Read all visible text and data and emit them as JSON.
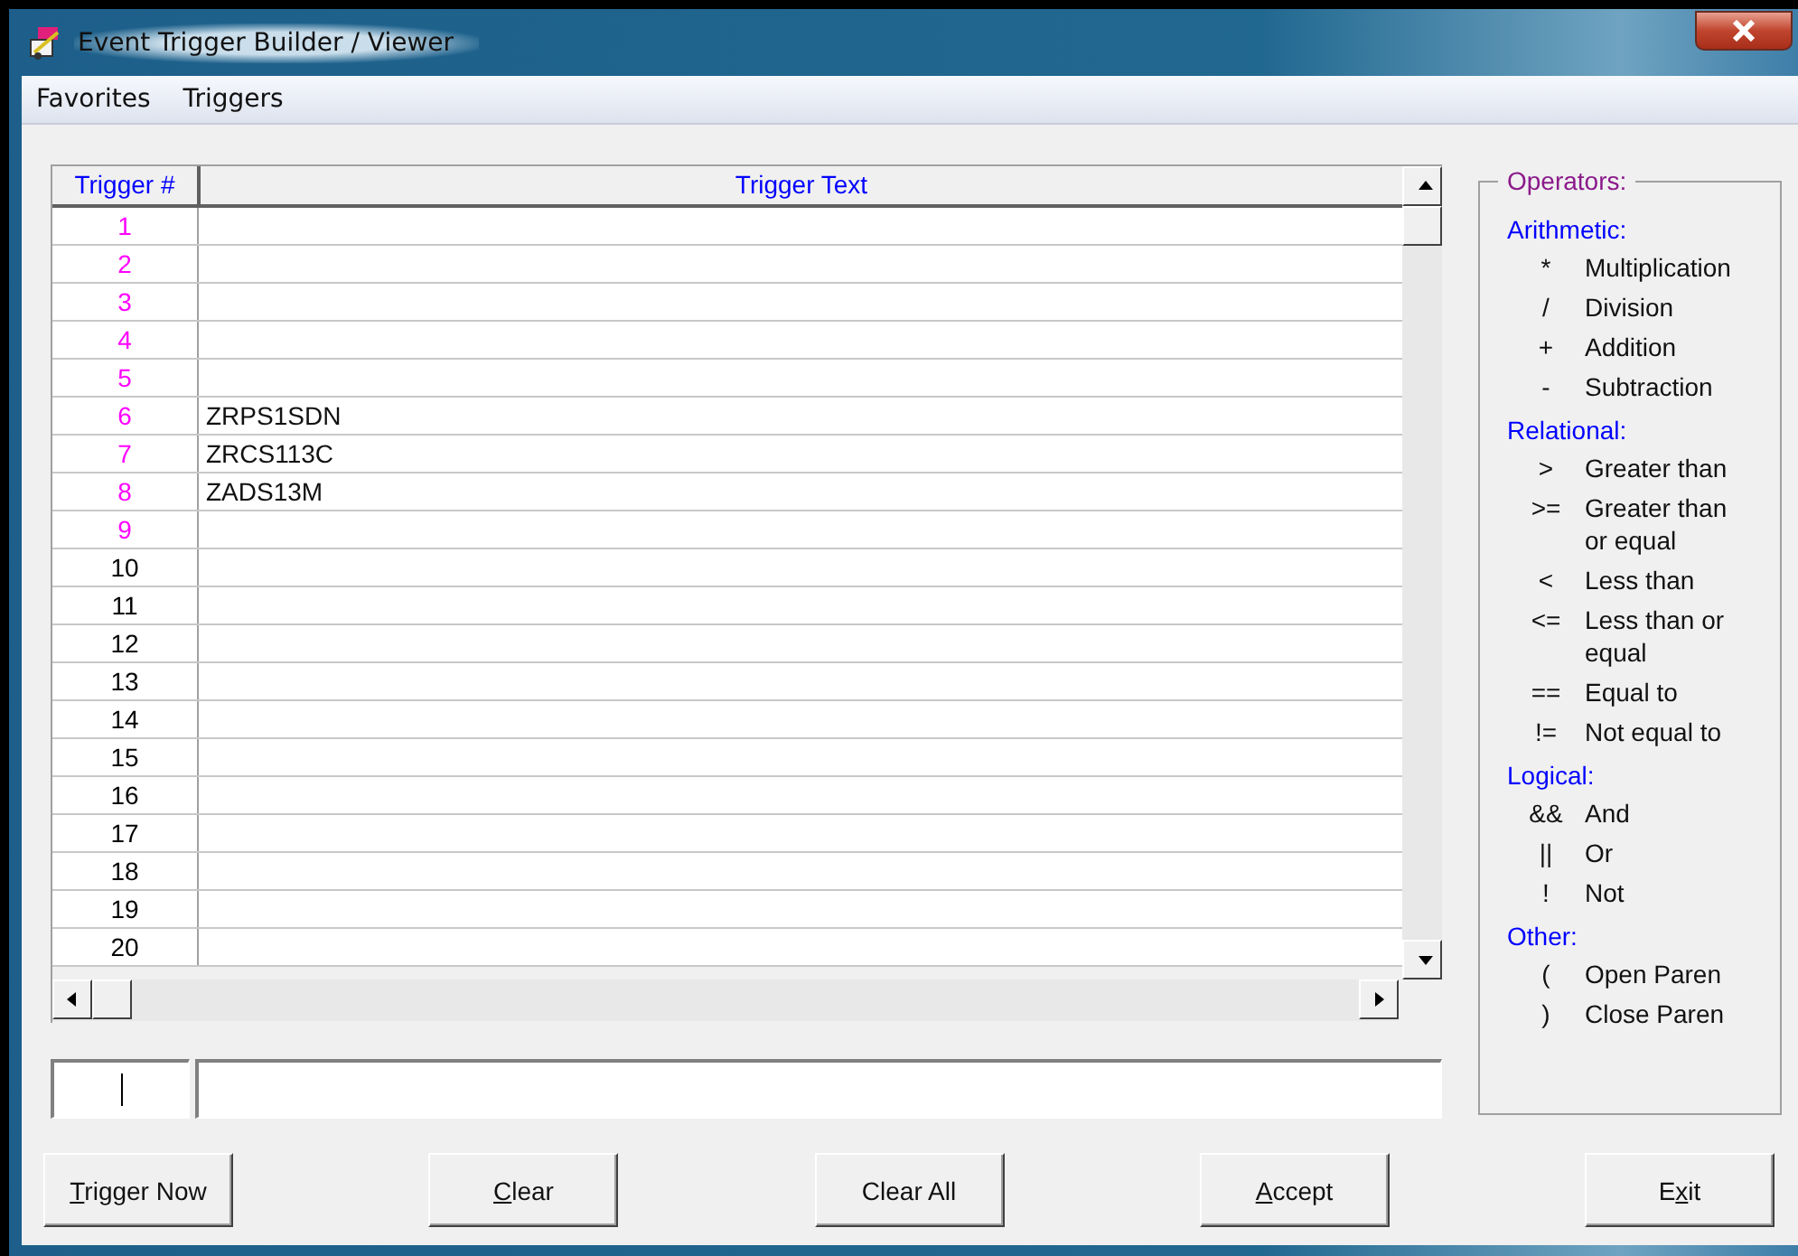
{
  "window": {
    "title": "Event Trigger Builder / Viewer"
  },
  "menu": [
    "Favorites",
    "Triggers"
  ],
  "grid": {
    "columns": [
      "Trigger #",
      "Trigger Text"
    ],
    "rows": [
      {
        "number": "1",
        "text": "",
        "color": "#ff00ff"
      },
      {
        "number": "2",
        "text": "",
        "color": "#ff00ff"
      },
      {
        "number": "3",
        "text": "",
        "color": "#ff00ff"
      },
      {
        "number": "4",
        "text": "",
        "color": "#ff00ff"
      },
      {
        "number": "5",
        "text": "",
        "color": "#ff00ff"
      },
      {
        "number": "6",
        "text": "ZRPS1SDN",
        "color": "#ff00ff"
      },
      {
        "number": "7",
        "text": "ZRCS113C",
        "color": "#ff00ff"
      },
      {
        "number": "8",
        "text": "ZADS13M",
        "color": "#ff00ff"
      },
      {
        "number": "9",
        "text": "",
        "color": "#ff00ff"
      },
      {
        "number": "10",
        "text": "",
        "color": "#000000"
      },
      {
        "number": "11",
        "text": "",
        "color": "#000000"
      },
      {
        "number": "12",
        "text": "",
        "color": "#000000"
      },
      {
        "number": "13",
        "text": "",
        "color": "#000000"
      },
      {
        "number": "14",
        "text": "",
        "color": "#000000"
      },
      {
        "number": "15",
        "text": "",
        "color": "#000000"
      },
      {
        "number": "16",
        "text": "",
        "color": "#000000"
      },
      {
        "number": "17",
        "text": "",
        "color": "#000000"
      },
      {
        "number": "18",
        "text": "",
        "color": "#000000"
      },
      {
        "number": "19",
        "text": "",
        "color": "#000000"
      },
      {
        "number": "20",
        "text": "",
        "color": "#000000"
      }
    ]
  },
  "operators": {
    "title": "Operators:",
    "groups": [
      {
        "title": "Arithmetic:",
        "items": [
          {
            "symbol": "*",
            "lines": [
              "Multiplication"
            ]
          },
          {
            "symbol": "/",
            "lines": [
              "Division"
            ]
          },
          {
            "symbol": "+",
            "lines": [
              "Addition"
            ]
          },
          {
            "symbol": "-",
            "lines": [
              "Subtraction"
            ]
          }
        ]
      },
      {
        "title": "Relational:",
        "items": [
          {
            "symbol": ">",
            "lines": [
              "Greater than"
            ]
          },
          {
            "symbol": ">=",
            "lines": [
              "Greater than",
              "or equal"
            ]
          },
          {
            "symbol": "<",
            "lines": [
              "Less than"
            ]
          },
          {
            "symbol": "<=",
            "lines": [
              "Less than or",
              "equal"
            ]
          },
          {
            "symbol": "==",
            "lines": [
              "Equal to"
            ]
          },
          {
            "symbol": "!=",
            "lines": [
              "Not equal to"
            ]
          }
        ]
      },
      {
        "title": "Logical:",
        "items": [
          {
            "symbol": "&&",
            "lines": [
              "And"
            ]
          },
          {
            "symbol": "||",
            "lines": [
              "Or"
            ]
          },
          {
            "symbol": "!",
            "lines": [
              "Not"
            ]
          }
        ]
      },
      {
        "title": "Other:",
        "items": [
          {
            "symbol": "(",
            "lines": [
              "Open Paren"
            ]
          },
          {
            "symbol": ")",
            "lines": [
              "Close Paren"
            ]
          }
        ]
      }
    ]
  },
  "buttons": [
    {
      "mnemonic": "T",
      "after": "rigger Now"
    },
    {
      "mnemonic": "C",
      "after": "lear"
    },
    {
      "before": "Clear All"
    },
    {
      "mnemonic": "A",
      "after": "ccept"
    },
    {
      "before": "E",
      "mnemonic": "x",
      "after": "it"
    }
  ]
}
